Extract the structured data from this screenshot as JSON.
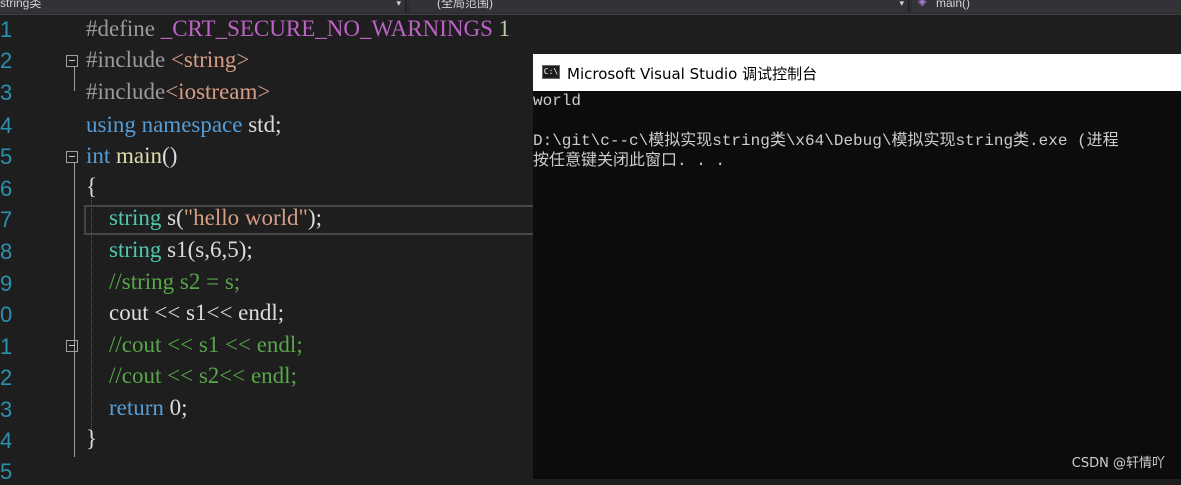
{
  "navbar": {
    "scope_dropdown": "string类",
    "global_dropdown": "(全局范围)",
    "member_dropdown": "main()"
  },
  "editor": {
    "line_numbers": [
      "1",
      "2",
      "3",
      "4",
      "5",
      "6",
      "7",
      "8",
      "9",
      "0",
      "1",
      "2",
      "3",
      "4",
      "5"
    ],
    "lines": {
      "l1": {
        "a": "#define ",
        "b": "_CRT_SECURE_NO_WARNINGS",
        "c": " 1"
      },
      "l2": {
        "a": "#include ",
        "b": "<string>"
      },
      "l3": {
        "a": "#include",
        "b": "<iostream>"
      },
      "l4": {
        "a": "using",
        "b": " ",
        "c": "namespace",
        "d": " std;"
      },
      "l5": {
        "a": "int",
        "b": " ",
        "c": "main",
        "d": "()"
      },
      "l6": {
        "a": "{"
      },
      "l7": {
        "a": "    ",
        "b": "string",
        "c": " s(",
        "d": "\"hello world\"",
        "e": ");"
      },
      "l8": {
        "a": "    ",
        "b": "string",
        "c": " s1(s,6,5);"
      },
      "l9": {
        "a": "    ",
        "b": "//string s2 = s;"
      },
      "l10": {
        "a": "    cout << s1<< endl;"
      },
      "l11": {
        "a": "    ",
        "b": "//cout << s1 << endl;"
      },
      "l12": {
        "a": "    ",
        "b": "//cout << s2<< endl;"
      },
      "l13": {
        "a": "    ",
        "b": "return",
        "c": " 0;"
      },
      "l14": {
        "a": "}"
      }
    }
  },
  "console": {
    "title": "Microsoft Visual Studio 调试控制台",
    "icon_label": "C:\\",
    "lines": [
      "world",
      "",
      "D:\\git\\c--c\\模拟实现string类\\x64\\Debug\\模拟实现string类.exe (进程",
      "按任意键关闭此窗口. . ."
    ]
  },
  "watermark": "CSDN @轩情吖",
  "colors": {
    "keyword": "#569cd6",
    "type": "#4ec9b0",
    "comment": "#57a64a",
    "string": "#d69d85",
    "line_number": "#2b91af",
    "background": "#1e1e1e"
  }
}
